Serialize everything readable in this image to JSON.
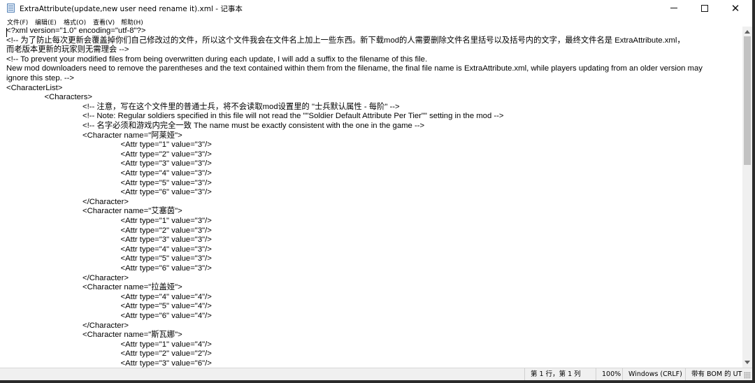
{
  "window": {
    "title": "ExtraAttribute(update,new user need rename it).xml - 记事本"
  },
  "menu": [
    {
      "label": "文件(F)"
    },
    {
      "label": "编辑(E)"
    },
    {
      "label": "格式(O)"
    },
    {
      "label": "查看(V)"
    },
    {
      "label": "帮助(H)"
    }
  ],
  "window_controls": {
    "minimize_icon": "minimize-icon",
    "maximize_icon": "maximize-icon",
    "close_glyph": "✕"
  },
  "document": {
    "lines": [
      "<?xml version=\"1.0\" encoding=\"utf-8\"?>",
      "<!-- 为了防止每次更新会覆盖掉你们自己修改过的文件，所以这个文件我会在文件名上加上一些东西。新下载mod的人需要删除文件名里括号以及括号内的文字，最终文件名是 ExtraAttribute.xml，",
      "而老版本更新的玩家则无需理会 -->",
      "<!-- To prevent your modified files from being overwritten during each update, I will add a suffix to the filename of this file.",
      "New mod downloaders need to remove the parentheses and the text contained within them from the filename, the final file name is ExtraAttribute.xml, while players updating from an older version may",
      "ignore this step. -->",
      "<CharacterList>",
      "\t<Characters>",
      "\t\t<!-- 注意，写在这个文件里的普通士兵，将不会读取mod设置里的 \"士兵默认属性 - 每阶\" -->",
      "\t\t<!-- Note: Regular soldiers specified in this file will not read the \"\"Soldier Default Attribute Per Tier\"\" setting in the mod -->",
      "\t\t<!-- 名字必须和游戏内完全一致 The name must be exactly consistent with the one in the game -->",
      "\t\t<Character name=\"阿莱娅\">",
      "\t\t\t<Attr type=\"1\" value=\"3\"/>",
      "\t\t\t<Attr type=\"2\" value=\"3\"/>",
      "\t\t\t<Attr type=\"3\" value=\"3\"/>",
      "\t\t\t<Attr type=\"4\" value=\"3\"/>",
      "\t\t\t<Attr type=\"5\" value=\"3\"/>",
      "\t\t\t<Attr type=\"6\" value=\"3\"/>",
      "\t\t</Character>",
      "\t\t<Character name=\"艾塞茵\">",
      "\t\t\t<Attr type=\"1\" value=\"3\"/>",
      "\t\t\t<Attr type=\"2\" value=\"3\"/>",
      "\t\t\t<Attr type=\"3\" value=\"3\"/>",
      "\t\t\t<Attr type=\"4\" value=\"3\"/>",
      "\t\t\t<Attr type=\"5\" value=\"3\"/>",
      "\t\t\t<Attr type=\"6\" value=\"3\"/>",
      "\t\t</Character>",
      "\t\t<Character name=\"拉盖娅\">",
      "\t\t\t<Attr type=\"4\" value=\"4\"/>",
      "\t\t\t<Attr type=\"5\" value=\"4\"/>",
      "\t\t\t<Attr type=\"6\" value=\"4\"/>",
      "\t\t</Character>",
      "\t\t<Character name=\"斯瓦娜\">",
      "\t\t\t<Attr type=\"1\" value=\"4\"/>",
      "\t\t\t<Attr type=\"2\" value=\"2\"/>",
      "\t\t\t<Attr type=\"3\" value=\"6\"/>"
    ]
  },
  "status": {
    "position": "第 1 行，第 1 列",
    "zoom": "100%",
    "line_ending": "Windows (CRLF)",
    "encoding": "带有 BOM 的 UT"
  }
}
